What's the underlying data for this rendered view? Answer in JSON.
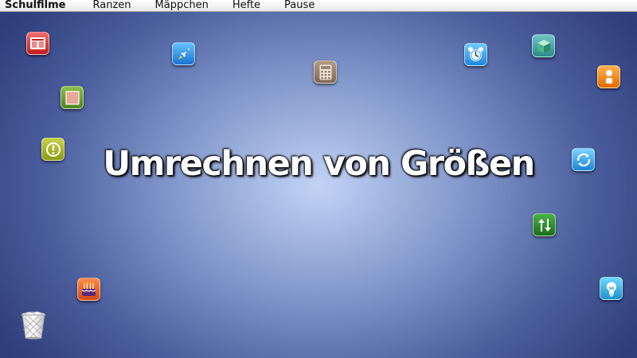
{
  "menubar": {
    "items": [
      "Schulfilme",
      "Ranzen",
      "Mäppchen",
      "Hefte",
      "Pause"
    ]
  },
  "title": "Umrechnen von Größen",
  "desktop_icons": [
    {
      "name": "newspaper-icon",
      "color": "#d9302f"
    },
    {
      "name": "rocket-icon",
      "color": "#2a8de0"
    },
    {
      "name": "calculator-icon",
      "color": "#977a63"
    },
    {
      "name": "alarm-clock-icon",
      "color": "#2a96e6"
    },
    {
      "name": "cube-icon",
      "color": "#3a9b9b"
    },
    {
      "name": "orange-dots-icon",
      "color": "#f2830d"
    },
    {
      "name": "green-square-icon",
      "color": "#659b2c"
    },
    {
      "name": "alert-icon",
      "color": "#a3b022"
    },
    {
      "name": "sync-icon",
      "color": "#2c98e0"
    },
    {
      "name": "up-down-arrows-icon",
      "color": "#2a8a2a"
    },
    {
      "name": "birthday-cake-icon",
      "color": "#e85a1a"
    },
    {
      "name": "lightbulb-icon",
      "color": "#2aa6d8"
    },
    {
      "name": "trash-can-icon",
      "color": "#cfcfcf"
    }
  ]
}
